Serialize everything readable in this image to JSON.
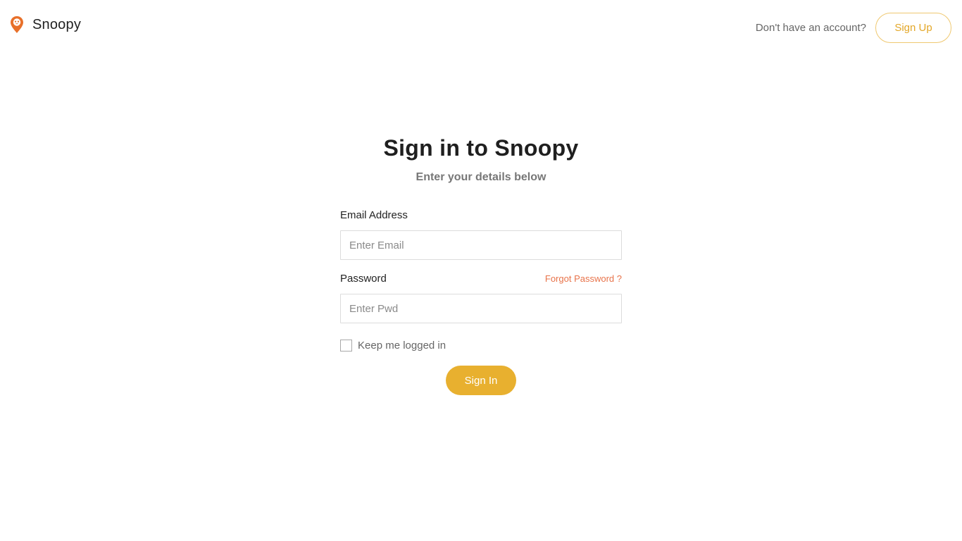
{
  "header": {
    "brand_name": "Snoopy",
    "brand_icon": "location-pin-icon",
    "account_prompt": "Don't have an account?",
    "signup_label": "Sign Up"
  },
  "form": {
    "title": "Sign in to Snoopy",
    "subtitle": "Enter your details below",
    "email": {
      "label": "Email Address",
      "value": "",
      "placeholder": "Enter Email"
    },
    "password": {
      "label": "Password",
      "value": "",
      "placeholder": "Enter Pwd"
    },
    "forgot_label": "Forgot Password ?",
    "keep_logged_in": {
      "label": "Keep me logged in",
      "checked": false
    },
    "signin_label": "Sign In"
  },
  "colors": {
    "accent": "#e8b02f",
    "signup_text": "#e3a728",
    "signup_border": "#efc870",
    "link": "#e8734a",
    "brand_icon": "#e8702a"
  }
}
